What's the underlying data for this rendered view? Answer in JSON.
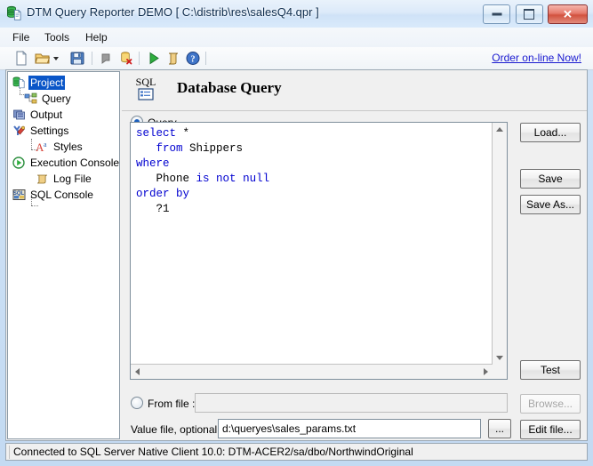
{
  "window": {
    "title": "DTM Query Reporter DEMO  [ C:\\distrib\\res\\salesQ4.qpr ]",
    "app_icon": "database-document-icon",
    "minimize_label": "Minimize",
    "maximize_label": "Maximize",
    "close_label": "✕"
  },
  "menubar": {
    "items": [
      {
        "label": "File"
      },
      {
        "label": "Tools"
      },
      {
        "label": "Help"
      }
    ]
  },
  "toolbar": {
    "buttons": [
      {
        "icon": "new-document-icon",
        "name": "new-button"
      },
      {
        "icon": "open-folder-icon",
        "name": "open-button"
      },
      {
        "icon": "chevron-down-icon",
        "name": "open-dropdown-button"
      },
      {
        "icon": "save-floppy-icon",
        "name": "save-button"
      },
      {
        "icon": "stop-icon",
        "name": "stop-button"
      },
      {
        "icon": "database-delete-icon",
        "name": "disconnect-button"
      },
      {
        "icon": "play-icon",
        "name": "run-button"
      },
      {
        "icon": "script-icon",
        "name": "log-button"
      },
      {
        "icon": "help-icon",
        "name": "help-button"
      }
    ],
    "order_link": "Order on-line Now!"
  },
  "tree": {
    "items": [
      {
        "label": "Project",
        "icon": "project-icon",
        "selected": true,
        "level": 0
      },
      {
        "label": "Query",
        "icon": "query-icon",
        "selected": false,
        "level": 1
      },
      {
        "label": "Output",
        "icon": "output-icon",
        "selected": false,
        "level": 0
      },
      {
        "label": "Settings",
        "icon": "settings-icon",
        "selected": false,
        "level": 0
      },
      {
        "label": "Styles",
        "icon": "styles-icon",
        "selected": false,
        "level": 1
      },
      {
        "label": "Execution Console",
        "icon": "execution-console-icon",
        "selected": false,
        "level": 0
      },
      {
        "label": "Log File",
        "icon": "log-file-icon",
        "selected": false,
        "level": 1
      },
      {
        "label": "SQL Console",
        "icon": "sql-console-icon",
        "selected": false,
        "level": 0
      }
    ]
  },
  "panel": {
    "header_badge": "SQL",
    "header_title": "Database Query",
    "query_radio_label": "Query",
    "query_radio_selected": true,
    "sql": {
      "lines": [
        [
          {
            "t": "select",
            "k": true
          },
          {
            "t": " ",
            "k": false
          },
          {
            "t": "*",
            "k": false
          }
        ],
        [
          {
            "t": "   ",
            "k": false
          },
          {
            "t": "from",
            "k": true
          },
          {
            "t": " Shippers",
            "k": false
          }
        ],
        [
          {
            "t": "where",
            "k": true
          }
        ],
        [
          {
            "t": "   Phone ",
            "k": false
          },
          {
            "t": "is",
            "k": true
          },
          {
            "t": " ",
            "k": false
          },
          {
            "t": "not",
            "k": true
          },
          {
            "t": " ",
            "k": false
          },
          {
            "t": "null",
            "k": true
          }
        ],
        [
          {
            "t": "order",
            "k": true
          },
          {
            "t": " ",
            "k": false
          },
          {
            "t": "by",
            "k": true
          }
        ],
        [
          {
            "t": "   ?1",
            "k": false
          }
        ]
      ],
      "plain": "select *\n   from Shippers\nwhere\n   Phone is not null\norder by\n   ?1"
    },
    "buttons": {
      "load": "Load...",
      "save": "Save",
      "save_as": "Save As...",
      "test": "Test",
      "browse": "Browse...",
      "edit_file": "Edit file...",
      "ellipsis": "..."
    },
    "from_file": {
      "radio_label": "From file :",
      "radio_selected": false,
      "value": "",
      "placeholder": ""
    },
    "value_file": {
      "label": "Value file, optional :",
      "value": "d:\\queryes\\sales_params.txt",
      "placeholder": ""
    }
  },
  "statusbar": {
    "text": "Connected to SQL Server Native Client 10.0: DTM-ACER2/sa/dbo/NorthwindOriginal"
  },
  "colors": {
    "keyword": "#0000d0",
    "link": "#1a1ad0",
    "selection": "#0a56c8",
    "frame": "#c3daf2"
  }
}
